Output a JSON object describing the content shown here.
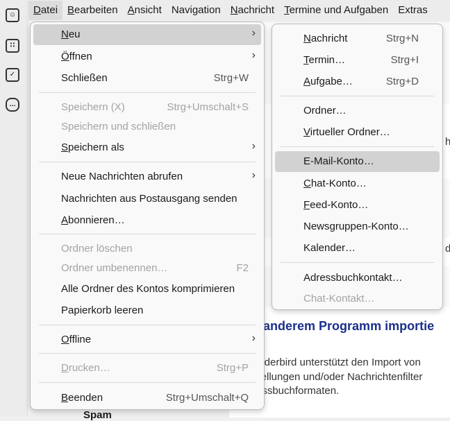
{
  "sidebar": {
    "icons": [
      "address-book-icon",
      "calendar-icon",
      "tasks-icon",
      "chat-icon"
    ]
  },
  "menubar": [
    {
      "label": "Datei",
      "u": 0
    },
    {
      "label": "Bearbeiten",
      "u": 0
    },
    {
      "label": "Ansicht",
      "u": 0
    },
    {
      "label": "Navigation",
      "u": 2
    },
    {
      "label": "Nachricht",
      "u": 0
    },
    {
      "label": "Termine und Aufgaben",
      "u": 0
    },
    {
      "label": "Extras",
      "u": 1
    }
  ],
  "file_menu": [
    {
      "label": "Neu",
      "u": 0,
      "submenu": true,
      "highlighted": true
    },
    {
      "label": "Öffnen",
      "u": 0,
      "submenu": true
    },
    {
      "label": "Schließen",
      "u": 1,
      "shortcut": "Strg+W"
    },
    {
      "sep": true
    },
    {
      "label": "Speichern (X)",
      "u": -1,
      "shortcut": "Strg+Umschalt+S",
      "disabled": true
    },
    {
      "label": "Speichern und schließen",
      "u": 3,
      "disabled": true
    },
    {
      "label": "Speichern als",
      "u": 0,
      "submenu": true
    },
    {
      "sep": true
    },
    {
      "label": "Neue Nachrichten abrufen",
      "u": 20,
      "submenu": true
    },
    {
      "label": "Nachrichten aus Postausgang senden",
      "u": 15
    },
    {
      "label": "Abonnieren…",
      "u": 0
    },
    {
      "sep": true
    },
    {
      "label": "Ordner löschen",
      "u": 7,
      "disabled": true
    },
    {
      "label": "Ordner umbenennen…",
      "u": 7,
      "shortcut": "F2",
      "disabled": true
    },
    {
      "label": "Alle Ordner des Kontos komprimieren",
      "u": 25
    },
    {
      "label": "Papierkorb leeren",
      "u": 6
    },
    {
      "sep": true
    },
    {
      "label": "Offline",
      "u": 0,
      "submenu": true
    },
    {
      "sep": true
    },
    {
      "label": "Drucken…",
      "u": 0,
      "shortcut": "Strg+P",
      "disabled": true
    },
    {
      "sep": true
    },
    {
      "label": "Beenden",
      "u": 0,
      "shortcut": "Strg+Umschalt+Q"
    }
  ],
  "new_submenu": [
    {
      "label": "Nachricht",
      "u": 0,
      "shortcut": "Strg+N"
    },
    {
      "label": "Termin…",
      "u": 0,
      "shortcut": "Strg+I"
    },
    {
      "label": "Aufgabe…",
      "u": 0,
      "shortcut": "Strg+D"
    },
    {
      "sep": true
    },
    {
      "label": "Ordner…",
      "u": 2
    },
    {
      "label": "Virtueller Ordner…",
      "u": 0
    },
    {
      "sep": true
    },
    {
      "label": "E-Mail-Konto…",
      "u": 2,
      "highlighted": true
    },
    {
      "label": "Chat-Konto…",
      "u": 0
    },
    {
      "label": "Feed-Konto…",
      "u": 0
    },
    {
      "label": "Newsgruppen-Konto…",
      "u": -1
    },
    {
      "label": "Kalender…",
      "u": 2
    },
    {
      "sep": true
    },
    {
      "label": "Adressbuchkontakt…",
      "u": 9
    },
    {
      "label": "Chat-Kontakt…",
      "u": 1,
      "disabled": true
    }
  ],
  "content": {
    "heading": "s anderem Programm importie",
    "lines": [
      "underbird unterstützt den Import von",
      "stellungen und/oder Nachrichtenfilter",
      "ressbuchformaten."
    ],
    "fragments": [
      "h",
      "d"
    ],
    "folder_behind": "Spam"
  }
}
